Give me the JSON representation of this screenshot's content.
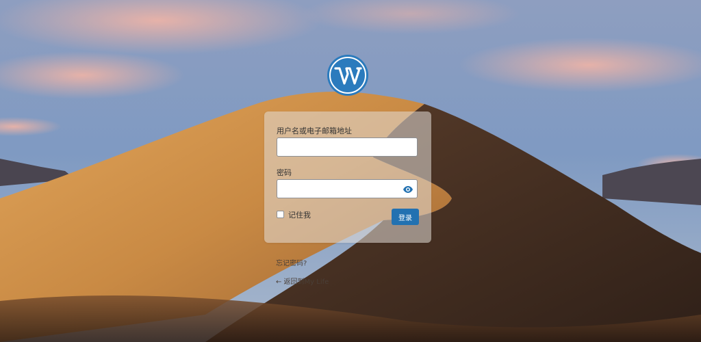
{
  "login": {
    "username_label": "用户名或电子邮箱地址",
    "username_value": "",
    "password_label": "密码",
    "password_value": "",
    "remember_label": "记住我",
    "submit_label": "登录"
  },
  "links": {
    "lost_password": "忘记密码?",
    "back_to_site": "← 返回到My Life"
  },
  "icons": {
    "logo": "wordpress-logo-icon",
    "password_toggle": "eye-icon"
  },
  "colors": {
    "brand": "#2271b1",
    "logo": "#2b7bbd"
  }
}
